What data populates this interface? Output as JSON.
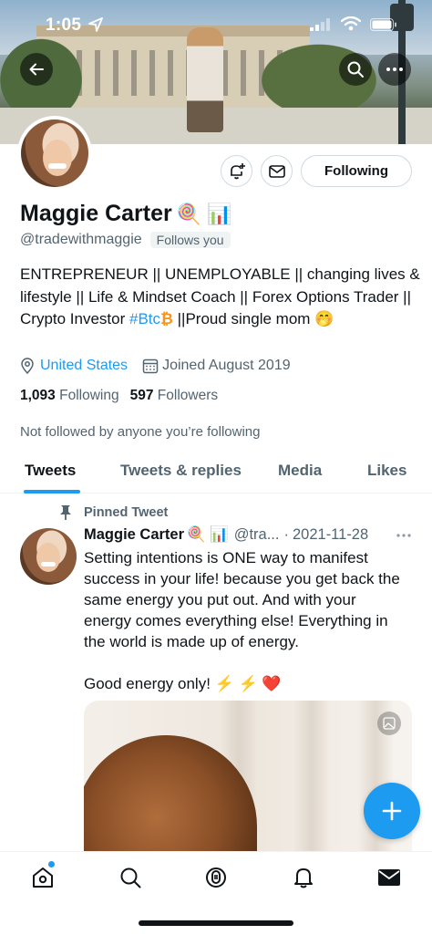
{
  "status_bar": {
    "time": "1:05"
  },
  "profile": {
    "name": "Maggie Carter",
    "name_emojis": "🍭 📊",
    "handle": "@tradewithmaggie",
    "follows_you": "Follows you",
    "following_button": "Following",
    "bio_part1": "ENTREPRENEUR || UNEMPLOYABLE || changing lives & lifestyle || Life & Mindset Coach || Forex Options Trader || Crypto Investor ",
    "bio_hashtag": "#Btc",
    "bio_btc_emoji": "₿",
    "bio_part2": " ||Proud single mom ",
    "bio_emoji": "🤭",
    "location": "United States",
    "joined": "Joined August 2019",
    "following_count": "1,093",
    "following_label": "Following",
    "followers_count": "597",
    "followers_label": "Followers",
    "not_followed": "Not followed by anyone you’re following"
  },
  "tabs": [
    {
      "label": "Tweets",
      "active": true
    },
    {
      "label": "Tweets & replies",
      "active": false
    },
    {
      "label": "Media",
      "active": false
    },
    {
      "label": "Likes",
      "active": false
    }
  ],
  "pinned_tweet": {
    "pinned_label": "Pinned Tweet",
    "author_name": "Maggie Carter",
    "author_emojis": "🍭 📊",
    "handle_truncated": "@tra...",
    "separator": "·",
    "date": "2021-11-28",
    "text": "Setting intentions is ONE way to manifest success in your life! because you get back the same energy you put out. And with your energy comes everything else! Everything in the world is made up of energy.\n\nGood energy only! ⚡ ⚡ ❤️"
  },
  "colors": {
    "accent": "#1d9bf0",
    "text_primary": "#0f1419",
    "text_secondary": "#536471",
    "border": "#cfd9de"
  },
  "icons": {
    "back": "back-arrow-icon",
    "search": "search-icon",
    "more": "more-icon",
    "notify": "bell-plus-icon",
    "message": "envelope-icon",
    "location": "location-pin-icon",
    "calendar": "calendar-icon",
    "pin": "pin-icon",
    "compose": "plus-icon",
    "nav": [
      "home-icon",
      "search-icon",
      "spaces-icon",
      "bell-icon",
      "envelope-icon"
    ]
  }
}
